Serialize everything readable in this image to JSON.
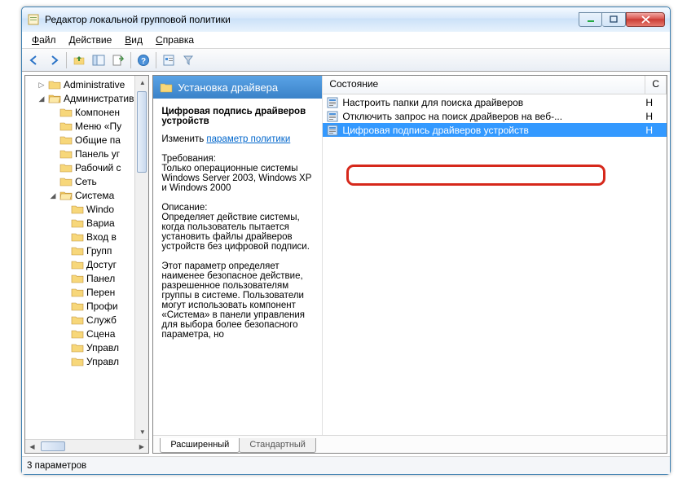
{
  "window": {
    "title": "Редактор локальной групповой политики"
  },
  "menu": {
    "file": "Файл",
    "action": "Действие",
    "view": "Вид",
    "help": "Справка"
  },
  "toolbar_icons": {
    "back": "back-arrow",
    "forward": "forward-arrow",
    "up": "folder-up",
    "show_tree": "show-tree",
    "export": "export-list",
    "help": "help",
    "properties": "properties",
    "filter": "filter"
  },
  "tree": {
    "items": [
      {
        "depth": 1,
        "exp": "▷",
        "label": "Administrative",
        "kind": "closed"
      },
      {
        "depth": 1,
        "exp": "◢",
        "label": "Административ",
        "kind": "open"
      },
      {
        "depth": 2,
        "exp": "",
        "label": "Компонен",
        "kind": "closed"
      },
      {
        "depth": 2,
        "exp": "",
        "label": "Меню «Пу",
        "kind": "closed"
      },
      {
        "depth": 2,
        "exp": "",
        "label": "Общие па",
        "kind": "closed"
      },
      {
        "depth": 2,
        "exp": "",
        "label": "Панель уг",
        "kind": "closed"
      },
      {
        "depth": 2,
        "exp": "",
        "label": "Рабочий с",
        "kind": "closed"
      },
      {
        "depth": 2,
        "exp": "",
        "label": "Сеть",
        "kind": "closed"
      },
      {
        "depth": 2,
        "exp": "◢",
        "label": "Система",
        "kind": "open"
      },
      {
        "depth": 3,
        "exp": "",
        "label": "Windo",
        "kind": "closed"
      },
      {
        "depth": 3,
        "exp": "",
        "label": "Вариа",
        "kind": "closed"
      },
      {
        "depth": 3,
        "exp": "",
        "label": "Вход в",
        "kind": "closed"
      },
      {
        "depth": 3,
        "exp": "",
        "label": "Групп",
        "kind": "closed"
      },
      {
        "depth": 3,
        "exp": "",
        "label": "Достуг",
        "kind": "closed"
      },
      {
        "depth": 3,
        "exp": "",
        "label": "Панел",
        "kind": "closed"
      },
      {
        "depth": 3,
        "exp": "",
        "label": "Перен",
        "kind": "closed"
      },
      {
        "depth": 3,
        "exp": "",
        "label": "Профи",
        "kind": "closed"
      },
      {
        "depth": 3,
        "exp": "",
        "label": "Служб",
        "kind": "closed"
      },
      {
        "depth": 3,
        "exp": "",
        "label": "Сцена",
        "kind": "closed"
      },
      {
        "depth": 3,
        "exp": "",
        "label": "Управл",
        "kind": "closed"
      },
      {
        "depth": 3,
        "exp": "",
        "label": "Управл",
        "kind": "closed"
      }
    ]
  },
  "desc": {
    "header": "Установка драйвера",
    "title": "Цифровая подпись драйверов устройств",
    "edit_prefix": "Изменить",
    "edit_link": "параметр политики",
    "req_label": "Требования:",
    "req_text": "Только операционные системы Windows Server 2003, Windows XP и Windows 2000",
    "desc_label": "Описание:",
    "desc_text1": "Определяет действие системы, когда пользователь пытается установить файлы драйверов устройств без цифровой подписи.",
    "desc_text2": "Этот параметр определяет наименее безопасное действие, разрешенное пользователям группы в системе. Пользователи могут использовать компонент «Система» в панели управления для выбора более безопасного параметра, но"
  },
  "list": {
    "col_settings": "Состояние",
    "col_state_short": "С",
    "rows": [
      {
        "label": "Настроить папки для поиска драйверов",
        "state_short": "Н",
        "selected": false
      },
      {
        "label": "Отключить запрос на поиск драйверов на веб-...",
        "state_short": "Н",
        "selected": false
      },
      {
        "label": "Цифровая подпись драйверов устройств",
        "state_short": "Н",
        "selected": true
      }
    ]
  },
  "tabs": {
    "extended": "Расширенный",
    "standard": "Стандартный"
  },
  "status": "3 параметров"
}
